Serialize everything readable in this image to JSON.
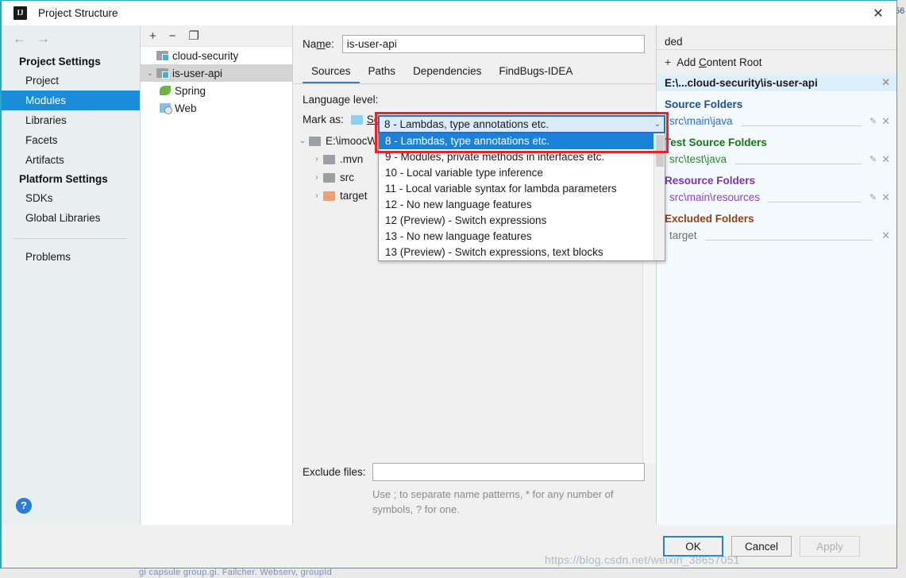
{
  "window": {
    "title": "Project Structure",
    "app_icon": "intellij-idea-icon",
    "close_label": "✕"
  },
  "nav": {
    "back_icon": "←",
    "forward_icon": "→",
    "groups": [
      {
        "label": "Project Settings",
        "items": [
          "Project",
          "Modules",
          "Libraries",
          "Facets",
          "Artifacts"
        ]
      },
      {
        "label": "Platform Settings",
        "items": [
          "SDKs",
          "Global Libraries"
        ]
      }
    ],
    "selected": "Modules",
    "problems": "Problems",
    "help_label": "?"
  },
  "module_tree": {
    "toolbar": {
      "add": "+",
      "remove": "−",
      "copy": "❐"
    },
    "rows": [
      {
        "label": "cloud-security",
        "icon": "module-folder-icon",
        "indent": 1,
        "twisty": "",
        "selected": false
      },
      {
        "label": "is-user-api",
        "icon": "module-folder-icon",
        "indent": 0,
        "twisty": "⌄",
        "selected": true
      },
      {
        "label": "Spring",
        "icon": "spring-facet-icon",
        "indent": 2,
        "twisty": "",
        "selected": false
      },
      {
        "label": "Web",
        "icon": "web-facet-icon",
        "indent": 2,
        "twisty": "",
        "selected": false
      }
    ]
  },
  "center": {
    "name_label_pre": "Na",
    "name_label_accel": "m",
    "name_label_post": "e:",
    "name_value": "is-user-api",
    "tabs": [
      {
        "label": "Sources",
        "active": true
      },
      {
        "label": "Paths",
        "active": false
      },
      {
        "label": "Dependencies",
        "active": false
      },
      {
        "label": "FindBugs-IDEA",
        "active": false
      }
    ],
    "language_level_label": "Language level:",
    "mark_as_label": "Mark as:",
    "mark_as_chip": "So",
    "file_tree": [
      {
        "label": "E:\\imoocW",
        "icon": "folder-grey-icon",
        "indent": 0,
        "twisty": "⌄"
      },
      {
        "label": ".mvn",
        "icon": "folder-grey-icon",
        "indent": 1,
        "twisty": "›"
      },
      {
        "label": "src",
        "icon": "folder-grey-icon",
        "indent": 1,
        "twisty": "›"
      },
      {
        "label": "target",
        "icon": "folder-orange-icon",
        "indent": 1,
        "twisty": "›"
      }
    ],
    "exclude_label": "Exclude files:",
    "exclude_value": "",
    "exclude_hint_line1": "Use ; to separate name patterns, * for any number of",
    "exclude_hint_line2": "symbols, ? for one."
  },
  "combo": {
    "selected_value": "8 - Lambdas, type annotations etc.",
    "caret": "⌄",
    "options": [
      "8 - Lambdas, type annotations etc.",
      "9 - Modules, private methods in interfaces etc.",
      "10 - Local variable type inference",
      "11 - Local variable syntax for lambda parameters",
      "12 - No new language features",
      "12 (Preview) - Switch expressions",
      "13 - No new language features",
      "13 (Preview) - Switch expressions, text blocks"
    ],
    "highlight_index": 0,
    "highlight_color": "#1a82d8",
    "focus_box_color": "#ee2222"
  },
  "right": {
    "top_truncated_label": "ded",
    "add_content_root_pre": "Add ",
    "add_content_root_accel": "C",
    "add_content_root_post": "ontent Root",
    "content_root": "E:\\...cloud-security\\is-user-api",
    "groups": [
      {
        "title": "Source Folders",
        "color": "#1b4fa0",
        "entries": [
          {
            "path": "src\\main\\java",
            "editable": true
          }
        ]
      },
      {
        "title": "Test Source Folders",
        "color": "#107b10",
        "entries": [
          {
            "path": "src\\test\\java",
            "editable": true
          }
        ]
      },
      {
        "title": "Resource Folders",
        "color": "#8030c0",
        "entries": [
          {
            "path": "src\\main\\resources",
            "editable": true
          }
        ]
      },
      {
        "title": "Excluded Folders",
        "color": "#9c3b10",
        "entries": [
          {
            "path": "target",
            "editable": false
          }
        ]
      }
    ],
    "remove_icon": "✕",
    "edit_icon": "✎"
  },
  "footer": {
    "ok": "OK",
    "cancel": "Cancel",
    "apply": "Apply",
    "watermark": "https://blog.csdn.net/weixin_38657051"
  },
  "background": {
    "right_sliver_text": "56",
    "bottom_text": "gi capsule group.gi. Failcher. Webserv, groupId"
  }
}
